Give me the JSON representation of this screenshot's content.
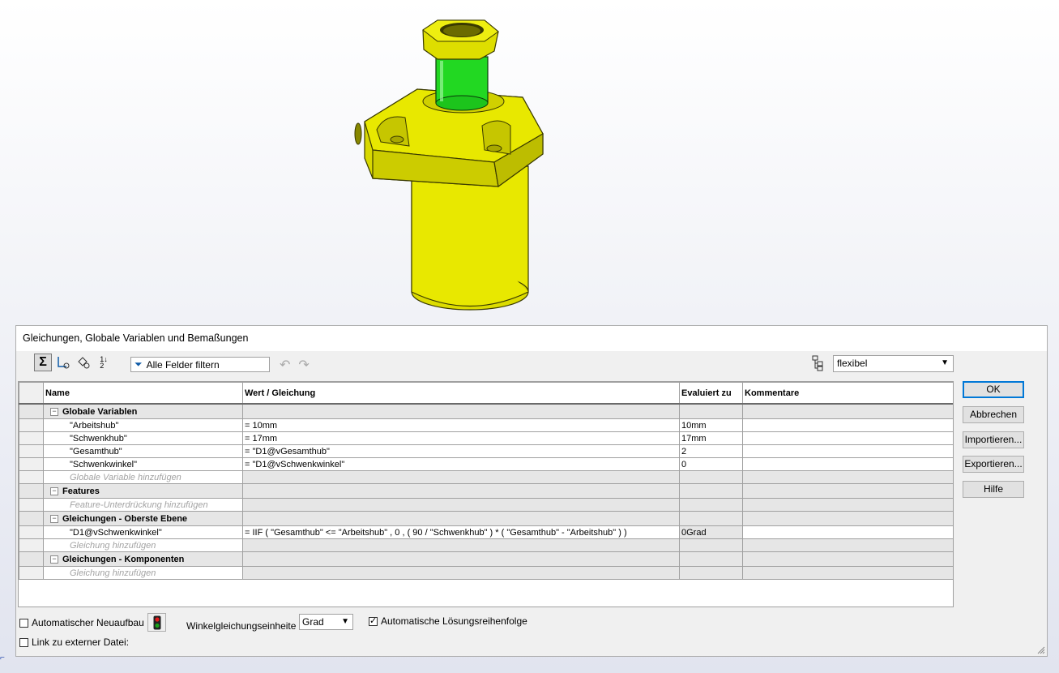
{
  "dialog": {
    "title": "Gleichungen, Globale Variablen und Bemaßungen",
    "filter_label": "Alle Felder filtern",
    "units_value": "flexibel",
    "columns": [
      "Name",
      "Wert / Gleichung",
      "Evaluiert zu",
      "Kommentare"
    ],
    "groups": {
      "global": {
        "title": "Globale Variablen",
        "rows": [
          {
            "name": "\"Arbeitshub\"",
            "value": "= 10mm",
            "eval": "10mm",
            "comment": ""
          },
          {
            "name": "\"Schwenkhub\"",
            "value": "= 17mm",
            "eval": "17mm",
            "comment": ""
          },
          {
            "name": "\"Gesamthub\"",
            "value": "= \"D1@vGesamthub\"",
            "eval": "2",
            "comment": ""
          },
          {
            "name": "\"Schwenkwinkel\"",
            "value": "= \"D1@vSchwenkwinkel\"",
            "eval": "0",
            "comment": ""
          }
        ],
        "add_label": "Globale Variable hinzufügen"
      },
      "features": {
        "title": "Features",
        "add_label": "Feature-Unterdrückung hinzufügen"
      },
      "top": {
        "title": "Gleichungen - Oberste Ebene",
        "rows": [
          {
            "name": "\"D1@vSchwenkwinkel\"",
            "value": "= IIF ( \"Gesamthub\" <= \"Arbeitshub\" , 0 , ( 90 / \"Schwenkhub\" ) * ( \"Gesamthub\" - \"Arbeitshub\" ) )",
            "eval": "0Grad",
            "comment": ""
          }
        ],
        "add_label": "Gleichung hinzufügen"
      },
      "components": {
        "title": "Gleichungen - Komponenten",
        "add_label": "Gleichung hinzufügen"
      }
    },
    "buttons": {
      "ok": "OK",
      "cancel": "Abbrechen",
      "import": "Importieren...",
      "export": "Exportieren...",
      "help": "Hilfe"
    },
    "bottom": {
      "auto_rebuild": "Automatischer Neuaufbau",
      "auto_rebuild_checked": false,
      "angle_unit_label": "Winkelgleichungseinheite",
      "angle_unit_value": "Grad",
      "auto_solve": "Automatische Lösungsreihenfolge",
      "auto_solve_checked": true,
      "link_external": "Link zu externer Datei:",
      "link_external_checked": false
    }
  },
  "colors": {
    "model_yellow": "#e6e600",
    "model_green": "#1ed21e",
    "default_button_border": "#0078d7"
  }
}
